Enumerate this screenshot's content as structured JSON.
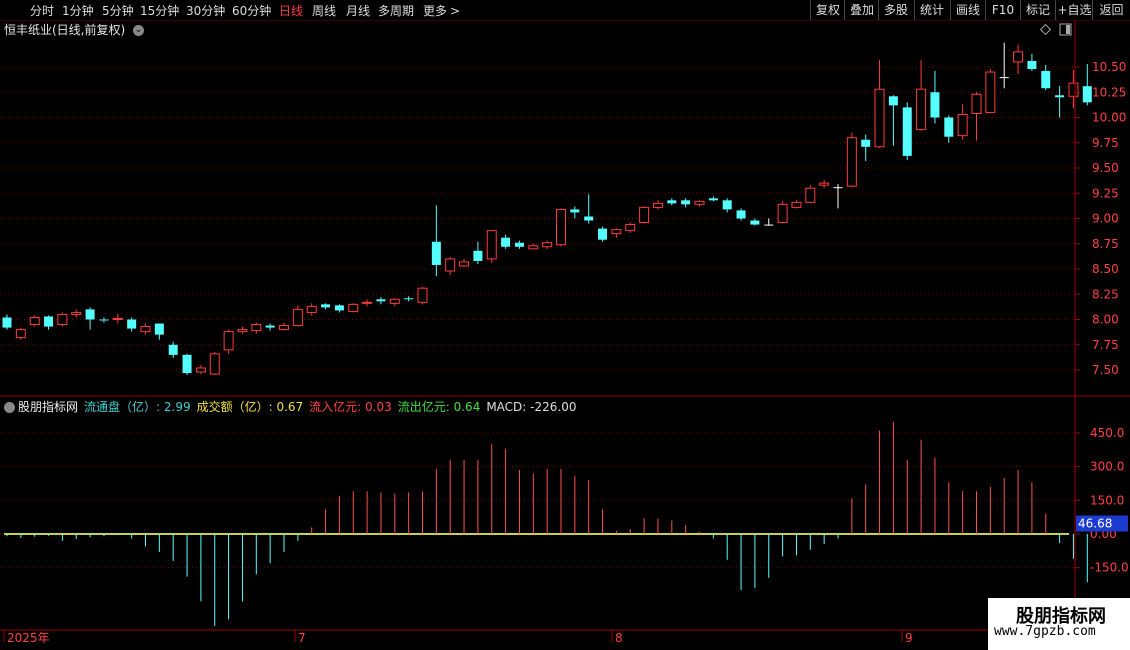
{
  "toolbar": {
    "periods": [
      "分时",
      "1分钟",
      "5分钟",
      "15分钟",
      "30分钟",
      "60分钟",
      "日线",
      "周线",
      "月线",
      "多周期",
      "更多"
    ],
    "active_period": "日线",
    "more_arrow": ">",
    "right_buttons": [
      "复权",
      "叠加",
      "多股",
      "统计",
      "画线",
      "F10",
      "标记",
      "+自选",
      "返回"
    ]
  },
  "stock": {
    "title": "恒丰纸业(日线,前复权)",
    "chevron": "⌄"
  },
  "indicator": {
    "name": "股朋指标网",
    "fields": [
      {
        "text": "流通盘（亿）: 2.99",
        "color": "#3fd0d0"
      },
      {
        "text": "成交额（亿）: 0.67",
        "color": "#f0e040"
      },
      {
        "text": "流入亿元: 0.03",
        "color": "#ff4040"
      },
      {
        "text": "流出亿元: 0.64",
        "color": "#40e040"
      },
      {
        "text": "MACD: -226.00",
        "color": "#dddddd"
      }
    ],
    "current_value": "46.68"
  },
  "price_axis": [
    "10.50",
    "10.25",
    "10.00",
    "9.75",
    "9.50",
    "9.25",
    "9.00",
    "8.75",
    "8.50",
    "8.25",
    "8.00",
    "7.75",
    "7.50"
  ],
  "indicator_axis": [
    "450.0",
    "300.0",
    "150.0",
    "0.00",
    "-150.0"
  ],
  "date_axis": [
    "2025年",
    "7",
    "8",
    "9"
  ],
  "watermark": {
    "line1": "股朋指标网",
    "line2": "www.7gpzb.com"
  },
  "colors": {
    "up": "#ff3b3b",
    "down": "#54ffff",
    "doji": "#ffffff",
    "grid": "#7a0000",
    "axis_text": "#ff4040"
  },
  "chart_data": {
    "type": "candlestick",
    "candles": [
      [
        8.02,
        7.92,
        8.05,
        7.9
      ],
      [
        7.82,
        7.9,
        7.92,
        7.8
      ],
      [
        7.95,
        8.02,
        8.04,
        7.93
      ],
      [
        8.03,
        7.93,
        8.04,
        7.9
      ],
      [
        7.95,
        8.05,
        8.07,
        7.93
      ],
      [
        8.05,
        8.07,
        8.1,
        8.02
      ],
      [
        8.1,
        8.0,
        8.12,
        7.9
      ],
      [
        8.0,
        7.99,
        8.02,
        7.97
      ],
      [
        8.0,
        8.01,
        8.06,
        7.96
      ],
      [
        8.0,
        7.91,
        8.02,
        7.88
      ],
      [
        7.88,
        7.93,
        7.96,
        7.85
      ],
      [
        7.96,
        7.85,
        7.96,
        7.8
      ],
      [
        7.75,
        7.65,
        7.78,
        7.62
      ],
      [
        7.65,
        7.47,
        7.66,
        7.45
      ],
      [
        7.48,
        7.52,
        7.55,
        7.46
      ],
      [
        7.46,
        7.66,
        7.68,
        7.45
      ],
      [
        7.7,
        7.88,
        7.9,
        7.66
      ],
      [
        7.88,
        7.9,
        7.93,
        7.86
      ],
      [
        7.89,
        7.95,
        7.97,
        7.86
      ],
      [
        7.94,
        7.92,
        7.96,
        7.89
      ],
      [
        7.9,
        7.94,
        7.97,
        7.89
      ],
      [
        7.94,
        8.1,
        8.14,
        7.93
      ],
      [
        8.07,
        8.13,
        8.16,
        8.04
      ],
      [
        8.15,
        8.12,
        8.16,
        8.1
      ],
      [
        8.14,
        8.09,
        8.15,
        8.07
      ],
      [
        8.08,
        8.15,
        8.16,
        8.07
      ],
      [
        8.16,
        8.17,
        8.2,
        8.13
      ],
      [
        8.2,
        8.18,
        8.22,
        8.15
      ],
      [
        8.16,
        8.2,
        8.21,
        8.13
      ],
      [
        8.21,
        8.2,
        8.23,
        8.18
      ],
      [
        8.17,
        8.31,
        8.32,
        8.15
      ],
      [
        8.77,
        8.54,
        9.13,
        8.43
      ],
      [
        8.48,
        8.6,
        8.62,
        8.44
      ],
      [
        8.53,
        8.57,
        8.6,
        8.52
      ],
      [
        8.68,
        8.58,
        8.77,
        8.55
      ],
      [
        8.6,
        8.88,
        8.88,
        8.56
      ],
      [
        8.81,
        8.72,
        8.84,
        8.7
      ],
      [
        8.76,
        8.72,
        8.78,
        8.7
      ],
      [
        8.7,
        8.73,
        8.75,
        8.69
      ],
      [
        8.72,
        8.76,
        8.78,
        8.7
      ],
      [
        8.74,
        9.09,
        9.1,
        8.72
      ],
      [
        9.09,
        9.06,
        9.12,
        9.0
      ],
      [
        9.02,
        8.98,
        9.24,
        8.95
      ],
      [
        8.9,
        8.79,
        8.92,
        8.77
      ],
      [
        8.85,
        8.89,
        8.9,
        8.81
      ],
      [
        8.88,
        8.94,
        8.96,
        8.86
      ],
      [
        8.96,
        9.11,
        9.12,
        8.95
      ],
      [
        9.11,
        9.15,
        9.18,
        9.09
      ],
      [
        9.18,
        9.15,
        9.2,
        9.13
      ],
      [
        9.18,
        9.14,
        9.2,
        9.11
      ],
      [
        9.14,
        9.17,
        9.18,
        9.12
      ],
      [
        9.2,
        9.18,
        9.22,
        9.17
      ],
      [
        9.18,
        9.09,
        9.2,
        9.06
      ],
      [
        9.08,
        9.0,
        9.1,
        8.98
      ],
      [
        8.98,
        8.94,
        9.0,
        8.93
      ],
      [
        8.94,
        8.94,
        9.0,
        8.93
      ],
      [
        8.96,
        9.14,
        9.17,
        8.95
      ],
      [
        9.11,
        9.16,
        9.18,
        9.1
      ],
      [
        9.16,
        9.3,
        9.33,
        9.15
      ],
      [
        9.33,
        9.35,
        9.38,
        9.3
      ],
      [
        9.31,
        9.31,
        9.34,
        9.1
      ],
      [
        9.32,
        9.8,
        9.85,
        9.31
      ],
      [
        9.78,
        9.71,
        9.83,
        9.57
      ],
      [
        9.71,
        10.28,
        10.57,
        9.7
      ],
      [
        10.21,
        10.12,
        10.22,
        9.72
      ],
      [
        10.1,
        9.62,
        10.15,
        9.58
      ],
      [
        9.88,
        10.28,
        10.57,
        9.87
      ],
      [
        10.25,
        10.0,
        10.46,
        9.94
      ],
      [
        10.0,
        9.81,
        10.02,
        9.75
      ],
      [
        9.82,
        10.03,
        10.13,
        9.78
      ],
      [
        10.04,
        10.23,
        10.25,
        9.77
      ],
      [
        10.05,
        10.45,
        10.48,
        10.04
      ],
      [
        10.4,
        10.4,
        10.74,
        10.29
      ],
      [
        10.55,
        10.65,
        10.72,
        10.43
      ],
      [
        10.56,
        10.48,
        10.63,
        10.46
      ],
      [
        10.46,
        10.29,
        10.52,
        10.27
      ],
      [
        10.22,
        10.2,
        10.31,
        10.0
      ],
      [
        10.21,
        10.34,
        10.47,
        10.09
      ],
      [
        10.31,
        10.15,
        10.53,
        10.12
      ]
    ],
    "indicator_bars": [
      -10,
      -18,
      -12,
      -8,
      -30,
      -22,
      -15,
      -10,
      -5,
      -20,
      -55,
      -80,
      -120,
      -190,
      -300,
      -410,
      -380,
      -300,
      -180,
      -130,
      -80,
      -30,
      30,
      110,
      170,
      190,
      190,
      185,
      180,
      185,
      190,
      290,
      330,
      330,
      330,
      400,
      380,
      285,
      270,
      290,
      290,
      260,
      240,
      110,
      15,
      22,
      70,
      68,
      60,
      40,
      10,
      -20,
      -115,
      -250,
      -240,
      -195,
      -100,
      -95,
      -70,
      -45,
      -20,
      160,
      220,
      460,
      500,
      330,
      420,
      340,
      230,
      190,
      190,
      210,
      250,
      285,
      230,
      90,
      -40,
      -110,
      -215
    ],
    "axis_range": [
      7.4,
      10.85
    ]
  }
}
